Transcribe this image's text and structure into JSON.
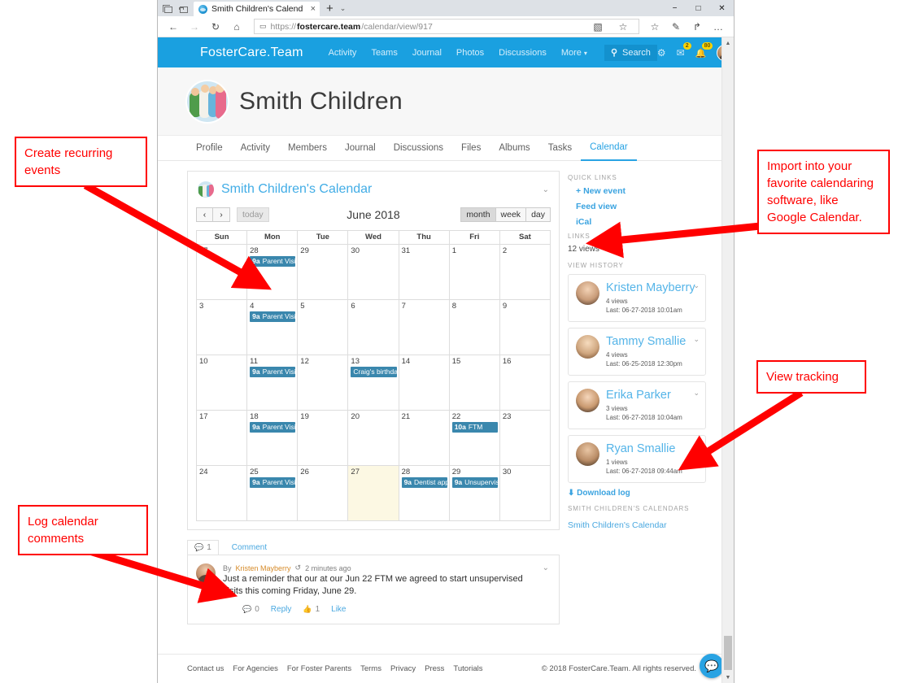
{
  "browser": {
    "tab_title": "Smith Children's Calend",
    "tab_close": "×",
    "new_tab": "+",
    "tab_list_chevron": "⌄",
    "minimize": "−",
    "maximize": "□",
    "close": "✕",
    "back": "←",
    "forward": "→",
    "refresh": "↻",
    "home": "⌂",
    "lock": "▭",
    "url_scheme": "https://",
    "url_host": "fostercare.team",
    "url_path": "/calendar/view/917",
    "reading_view": "▧",
    "favorite": "☆",
    "favorites_hub": "☆",
    "notes": "✎",
    "share": "↱",
    "more": "…"
  },
  "navbar": {
    "brand": "FosterCare.Team",
    "links": [
      "Activity",
      "Teams",
      "Journal",
      "Photos",
      "Discussions"
    ],
    "more_label": "More",
    "more_caret": "▾",
    "search_placeholder": "Search",
    "search_icon": "⚲",
    "gear_icon": "⚙",
    "mail_icon": "✉",
    "mail_badge": "2",
    "bell_icon": "🔔",
    "bell_badge": "80",
    "accent_color": "#1aa0e0"
  },
  "hero": {
    "title": "Smith Children"
  },
  "profile_tabs": {
    "items": [
      "Profile",
      "Activity",
      "Members",
      "Journal",
      "Discussions",
      "Files",
      "Albums",
      "Tasks",
      "Calendar"
    ],
    "active": "Calendar"
  },
  "calendar": {
    "title": "Smith Children's Calendar",
    "chevron": "⌄",
    "prev": "‹",
    "next": "›",
    "today_label": "today",
    "period_title": "June 2018",
    "views": [
      "month",
      "week",
      "day"
    ],
    "active_view": "month",
    "weekday_headers": [
      "Sun",
      "Mon",
      "Tue",
      "Wed",
      "Thu",
      "Fri",
      "Sat"
    ],
    "event_color": "#3a87ad",
    "today_cell_color": "#fcf8e3",
    "weeks": [
      [
        {
          "day": "27",
          "other": true,
          "events": []
        },
        {
          "day": "28",
          "other": true,
          "events": [
            {
              "time": "9a",
              "title": "Parent Visits"
            }
          ]
        },
        {
          "day": "29",
          "other": true,
          "events": []
        },
        {
          "day": "30",
          "other": true,
          "events": []
        },
        {
          "day": "31",
          "other": true,
          "events": []
        },
        {
          "day": "1",
          "other": false,
          "events": []
        },
        {
          "day": "2",
          "other": false,
          "events": []
        }
      ],
      [
        {
          "day": "3",
          "other": false,
          "events": []
        },
        {
          "day": "4",
          "other": false,
          "events": [
            {
              "time": "9a",
              "title": "Parent Visits"
            }
          ]
        },
        {
          "day": "5",
          "other": false,
          "events": []
        },
        {
          "day": "6",
          "other": false,
          "events": []
        },
        {
          "day": "7",
          "other": false,
          "events": []
        },
        {
          "day": "8",
          "other": false,
          "events": []
        },
        {
          "day": "9",
          "other": false,
          "events": []
        }
      ],
      [
        {
          "day": "10",
          "other": false,
          "events": []
        },
        {
          "day": "11",
          "other": false,
          "events": [
            {
              "time": "9a",
              "title": "Parent Visits"
            }
          ]
        },
        {
          "day": "12",
          "other": false,
          "events": []
        },
        {
          "day": "13",
          "other": false,
          "events": [
            {
              "time": "",
              "title": "Craig's birthday"
            }
          ]
        },
        {
          "day": "14",
          "other": false,
          "events": []
        },
        {
          "day": "15",
          "other": false,
          "events": []
        },
        {
          "day": "16",
          "other": false,
          "events": []
        }
      ],
      [
        {
          "day": "17",
          "other": false,
          "events": []
        },
        {
          "day": "18",
          "other": false,
          "events": [
            {
              "time": "9a",
              "title": "Parent Visits"
            }
          ]
        },
        {
          "day": "19",
          "other": false,
          "events": []
        },
        {
          "day": "20",
          "other": false,
          "events": []
        },
        {
          "day": "21",
          "other": false,
          "events": []
        },
        {
          "day": "22",
          "other": false,
          "events": [
            {
              "time": "10a",
              "title": "FTM"
            }
          ]
        },
        {
          "day": "23",
          "other": false,
          "events": []
        }
      ],
      [
        {
          "day": "24",
          "other": false,
          "events": []
        },
        {
          "day": "25",
          "other": false,
          "events": [
            {
              "time": "9a",
              "title": "Parent Visits"
            }
          ]
        },
        {
          "day": "26",
          "other": false,
          "events": []
        },
        {
          "day": "27",
          "other": false,
          "today": true,
          "events": []
        },
        {
          "day": "28",
          "other": false,
          "events": [
            {
              "time": "9a",
              "title": "Dentist appoi"
            }
          ]
        },
        {
          "day": "29",
          "other": false,
          "events": [
            {
              "time": "9a",
              "title": "Unsupervised"
            }
          ]
        },
        {
          "day": "30",
          "other": false,
          "events": []
        }
      ]
    ]
  },
  "comments": {
    "count_tab": "1",
    "count_icon": "💬",
    "comment_tab_label": "Comment",
    "by_label": "By",
    "author": "Kristen Mayberry",
    "time_icon": "↺",
    "timestamp": "2 minutes ago",
    "text": "Just a reminder that our at our Jun 22 FTM we agreed to start unsupervised visits this coming Friday, June 29.",
    "reply_count": "0",
    "reply_label": "Reply",
    "like_count": "1",
    "like_label": "Like",
    "like_icon": "👍",
    "chevron": "⌄"
  },
  "sidebar": {
    "quick_links_header": "QUICK LINKS",
    "new_event": "New event",
    "feed_view": "Feed view",
    "ical": "iCal",
    "links_header": "LINKS",
    "views_count": "12 views",
    "view_history_header": "VIEW HISTORY",
    "viewers": [
      {
        "name": "Kristen Mayberry",
        "views": "4 views",
        "last": "Last: 06-27-2018 10:01am",
        "chevron": "⌄"
      },
      {
        "name": "Tammy Smallie",
        "views": "4 views",
        "last": "Last: 06-25-2018 12:30pm",
        "chevron": "⌄"
      },
      {
        "name": "Erika Parker",
        "views": "3 views",
        "last": "Last: 06-27-2018 10:04am",
        "chevron": "⌄"
      },
      {
        "name": "Ryan Smallie",
        "views": "1 views",
        "last": "Last: 06-27-2018 09:44am",
        "chevron": "⌄"
      }
    ],
    "download_log": "Download log",
    "download_icon": "⬇",
    "calendars_header": "SMITH CHILDREN'S CALENDARS",
    "calendar_link": "Smith Children's Calendar"
  },
  "footer": {
    "links": [
      "Contact us",
      "For Agencies",
      "For Foster Parents",
      "Terms",
      "Privacy",
      "Press",
      "Tutorials"
    ],
    "copyright": "© 2018 FosterCare.Team. All rights reserved.",
    "chat_icon": "💬"
  },
  "annotations": {
    "create_recurring": "Create recurring events",
    "import_ical": "Import into your favorite calendaring software, like Google Calendar.",
    "view_tracking": "View tracking",
    "log_comments": "Log calendar comments",
    "color": "#ff0000"
  }
}
